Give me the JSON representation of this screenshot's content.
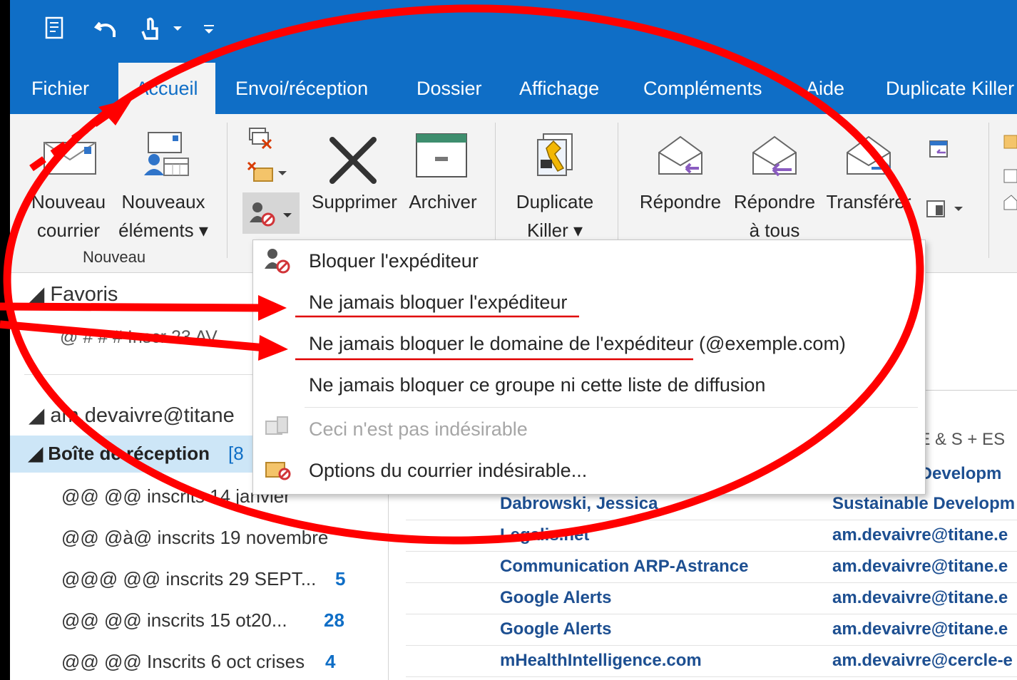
{
  "ribbon_tabs": [
    "Fichier",
    "Accueil",
    "Envoi/réception",
    "Dossier",
    "Affichage",
    "Compléments",
    "Aide",
    "Duplicate Killer"
  ],
  "active_tab": "Accueil",
  "ribbon": {
    "new_mail_line1": "Nouveau",
    "new_mail_line2": "courrier",
    "new_items_line1": "Nouveaux",
    "new_items_line2": "éléments ▾",
    "group_new": "Nouveau",
    "delete": "Supprimer",
    "archive": "Archiver",
    "dupkiller_line1": "Duplicate",
    "dupkiller_line2": "Killer ▾",
    "reply": "Répondre",
    "reply_all_line1": "Répondre",
    "reply_all_line2": "à tous",
    "forward": "Transférer"
  },
  "junk_menu": {
    "items": [
      {
        "label": "Bloquer l'expéditeur",
        "enabled": true
      },
      {
        "label": "Ne jamais bloquer l'expéditeur",
        "enabled": true
      },
      {
        "label": "Ne jamais bloquer le domaine de l'expéditeur (@exemple.com)",
        "enabled": true
      },
      {
        "label": "Ne jamais bloquer ce groupe ni cette liste de diffusion",
        "enabled": true
      },
      {
        "label": "Ceci n'est pas indésirable",
        "enabled": false
      },
      {
        "label": "Options du courrier indésirable...",
        "enabled": true
      }
    ]
  },
  "folders": {
    "favorites_header": "◢ Favoris",
    "favorite_item": "@ # # # Inscr 23 AV",
    "account": "◢ am.devaivre@titane",
    "inbox_label": "◢ Boîte de réception",
    "inbox_count": "[8",
    "subfolders": [
      {
        "name": "@@ @@ inscrits 14 janvier",
        "count": ""
      },
      {
        "name": "@@ @à@ inscrits 19 novembre",
        "count": ""
      },
      {
        "name": "@@@ @@ inscrits 29 SEPT...",
        "count": "5"
      },
      {
        "name": "@@ @@ inscrits 15 ot20...",
        "count": "28"
      },
      {
        "name": "@@ @@ Inscrits 6 oct crises",
        "count": "4"
      }
    ]
  },
  "messages": {
    "partial_header": "le E & S + ES",
    "partial_first_to": "le Developm",
    "rows": [
      {
        "sender": "Dabrowski, Jessica",
        "to": "Sustainable Developm"
      },
      {
        "sender": "Legalis.net",
        "to": "am.devaivre@titane.e"
      },
      {
        "sender": "Communication ARP-Astrance",
        "to": "am.devaivre@titane.e"
      },
      {
        "sender": "Google Alerts",
        "to": "am.devaivre@titane.e"
      },
      {
        "sender": "Google Alerts",
        "to": "am.devaivre@titane.e"
      },
      {
        "sender": "mHealthIntelligence.com",
        "to": "am.devaivre@cercle-e"
      }
    ]
  },
  "colors": {
    "ribbon_blue": "#0f6ec6",
    "annotation_red": "#ff0000",
    "sender_blue": "#1d4f91"
  }
}
